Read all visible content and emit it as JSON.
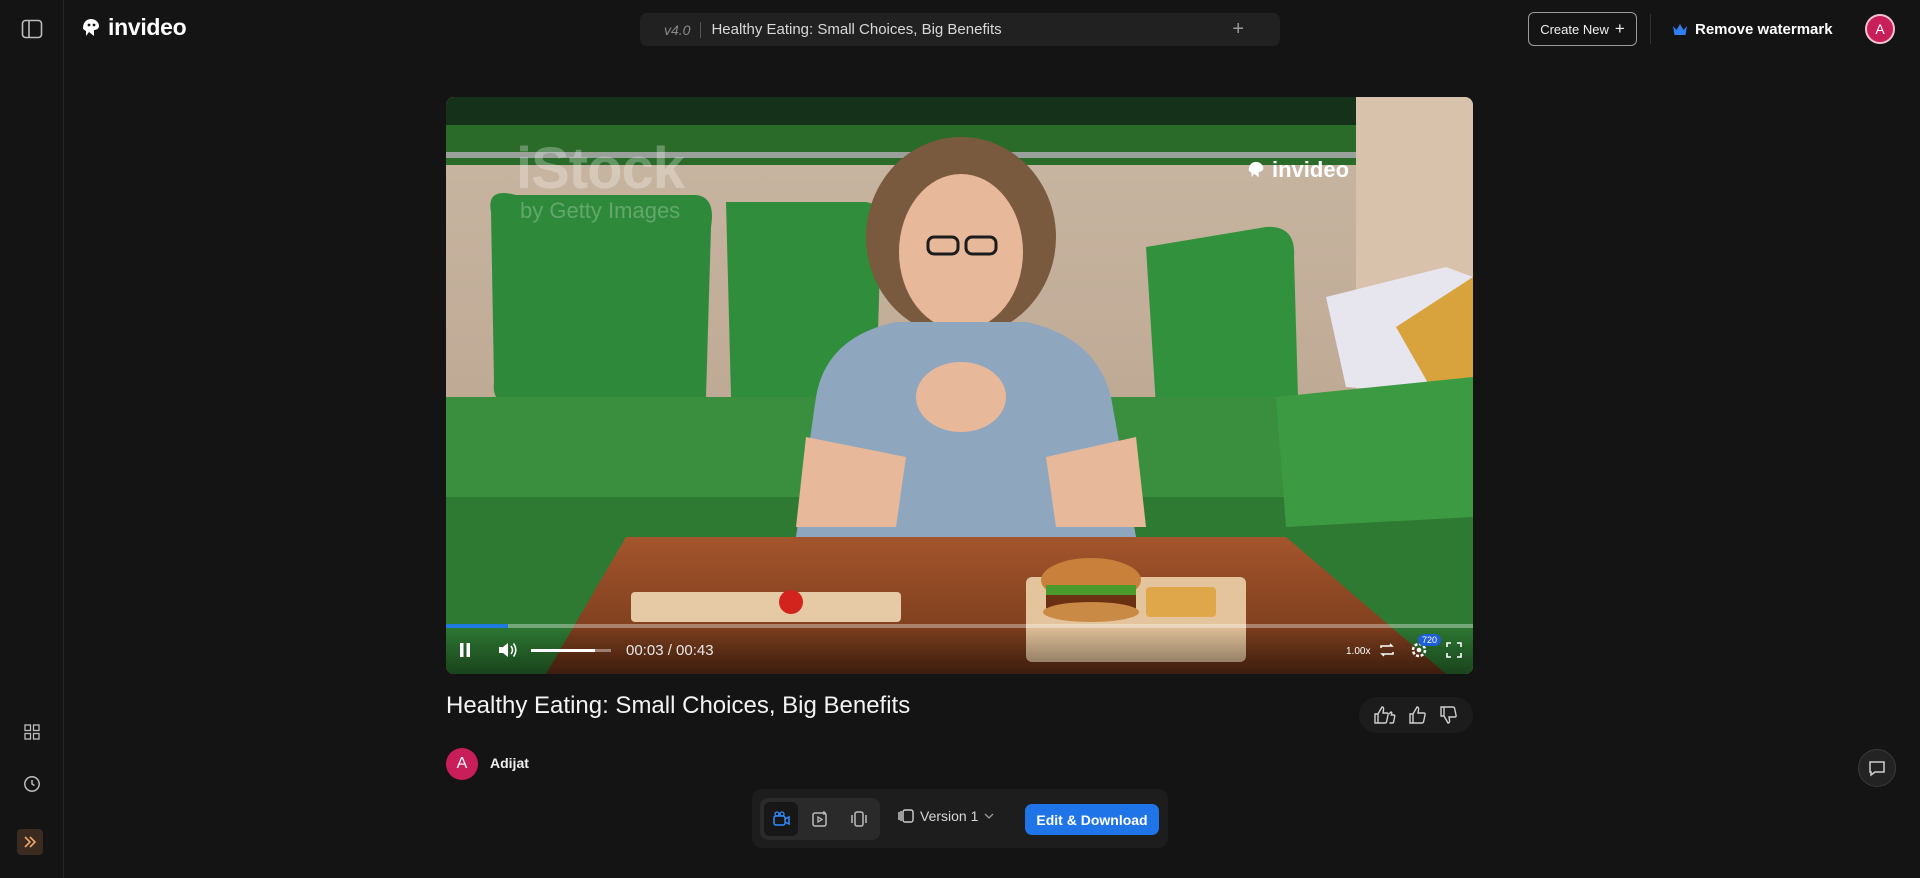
{
  "app": {
    "brand": "invideo"
  },
  "topbar": {
    "version": "v4.0",
    "project_title": "Healthy Eating: Small Choices, Big Benefits",
    "create_new_label": "Create New",
    "remove_watermark_label": "Remove watermark",
    "user_initial": "A"
  },
  "video": {
    "watermark_istock": "iStock",
    "watermark_getty": "by Getty Images",
    "watermark_brand": "invideo",
    "current_time": "00:03",
    "duration": "00:43",
    "time_display": "00:03 / 00:43",
    "progress_fraction": 0.06,
    "volume_fraction": 0.8,
    "speed": "1.00x",
    "quality": "720"
  },
  "details": {
    "title": "Healthy Eating: Small Choices, Big Benefits",
    "creator_initial": "A",
    "creator_name": "Adijat"
  },
  "toolbar": {
    "version_label": "Version 1",
    "edit_download_label": "Edit & Download"
  },
  "colors": {
    "accent": "#1f74e8",
    "avatar": "#c81e5a",
    "background": "#141414"
  }
}
